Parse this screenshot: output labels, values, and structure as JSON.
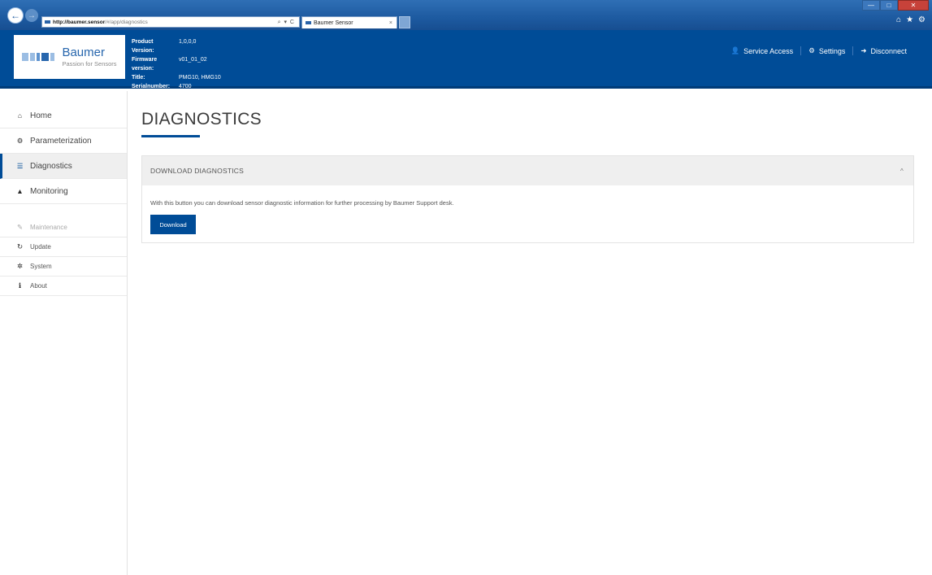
{
  "browser": {
    "url_host": "http://baumer.sensor",
    "url_path": "/#/app/diagnostics",
    "url_tools": "⌕ ▾ C",
    "tab_title": "Baumer Sensor",
    "tab_close": "×",
    "back_glyph": "←",
    "forward_glyph": "→",
    "window_controls": [
      "—",
      "□",
      "✕"
    ],
    "toolbar_icons": [
      "⌂",
      "★",
      "⚙"
    ]
  },
  "header": {
    "brand": {
      "name": "Baumer",
      "tagline": "Passion for Sensors",
      "colors": [
        "#9bbde3",
        "#5e93cf",
        "#2766ad"
      ]
    },
    "info": [
      {
        "key": "Product Version:",
        "value": "1,0,0,0"
      },
      {
        "key": "Firmware version:",
        "value": "v01_01_02"
      },
      {
        "key": "Title:",
        "value": "PMG10, HMG10"
      },
      {
        "key": "Serialnumber:",
        "value": "4700"
      }
    ],
    "actions": [
      {
        "label": "Service Access",
        "icon": "user-icon",
        "glyph": "👤"
      },
      {
        "label": "Settings",
        "icon": "gear-icon",
        "glyph": "⚙"
      },
      {
        "label": "Disconnect",
        "icon": "sign-out-icon",
        "glyph": "➜"
      }
    ]
  },
  "sidebar": {
    "main": [
      {
        "label": "Home",
        "icon": "home-icon",
        "glyph": "⌂",
        "active": false
      },
      {
        "label": "Parameterization",
        "icon": "gears-icon",
        "glyph": "⚙",
        "active": false
      },
      {
        "label": "Diagnostics",
        "icon": "list-icon",
        "glyph": "☰",
        "active": true
      },
      {
        "label": "Monitoring",
        "icon": "area-chart-icon",
        "glyph": "▲",
        "active": false
      }
    ],
    "sub": [
      {
        "label": "Maintenance",
        "icon": "wrench-icon",
        "glyph": "✎",
        "muted": true
      },
      {
        "label": "Update",
        "icon": "refresh-icon",
        "glyph": "↻",
        "muted": false
      },
      {
        "label": "System",
        "icon": "cogs-icon",
        "glyph": "✲",
        "muted": false
      },
      {
        "label": "About",
        "icon": "info-icon",
        "glyph": "ℹ",
        "muted": false
      }
    ]
  },
  "main": {
    "title": "DIAGNOSTICS",
    "panel": {
      "heading": "DOWNLOAD DIAGNOSTICS",
      "collapse_glyph": "^",
      "description": "With this button you can download sensor diagnostic information for further processing by Baumer Support desk.",
      "button_label": "Download"
    }
  },
  "colors": {
    "brand_blue": "#004c97",
    "active_bg": "#efefef",
    "panel_header_bg": "#efefef"
  }
}
